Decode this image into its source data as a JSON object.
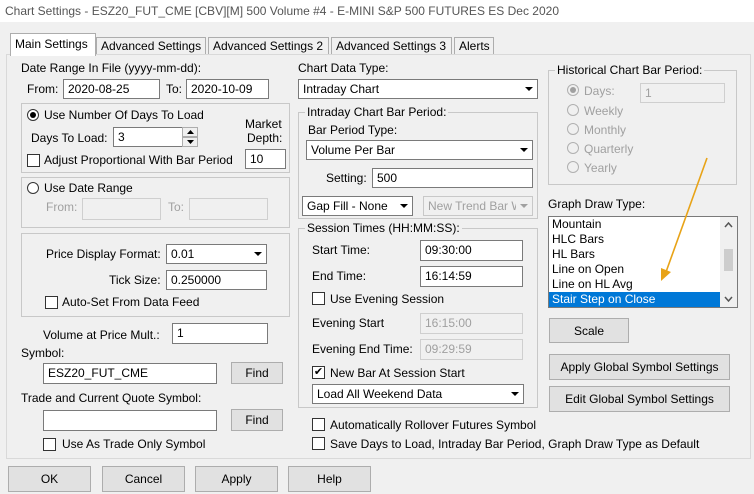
{
  "window": {
    "title": "Chart Settings - ESZ20_FUT_CME [CBV][M]  500 Volume  #4 - E-MINI S&P 500 FUTURES ES Dec 2020"
  },
  "tabs": [
    "Main Settings",
    "Advanced Settings",
    "Advanced Settings 2",
    "Advanced Settings 3",
    "Alerts"
  ],
  "date_range": {
    "label": "Date Range In File (yyyy-mm-dd):",
    "from_label": "From:",
    "from_value": "2020-08-25",
    "to_label": "To:",
    "to_value": "2020-10-09"
  },
  "days_to_load": {
    "radio_label": "Use Number Of Days To Load",
    "days_label": "Days To Load:",
    "days_value": "3",
    "market_depth_label_1": "Market",
    "market_depth_label_2": "Depth:",
    "market_depth_value": "10",
    "adjust_label": "Adjust Proportional With Bar Period"
  },
  "use_date_range": {
    "radio_label": "Use Date Range",
    "from_label": "From:",
    "to_label": "To:"
  },
  "price": {
    "format_label": "Price Display Format:",
    "format_value": "0.01",
    "tick_label": "Tick Size:",
    "tick_value": "0.250000",
    "auto_set_label": "Auto-Set From Data Feed"
  },
  "symbol": {
    "vap_label": "Volume at Price Mult.:",
    "vap_value": "1",
    "symbol_label": "Symbol:",
    "symbol_value": "ESZ20_FUT_CME",
    "find_label": "Find",
    "trade_label": "Trade and Current Quote Symbol:",
    "trade_value": "",
    "trade_find_label": "Find",
    "trade_only_label": "Use As Trade Only Symbol"
  },
  "chart_data_type": {
    "label": "Chart Data Type:",
    "value": "Intraday Chart"
  },
  "intraday_bar_period": {
    "title": "Intraday Chart Bar Period:",
    "type_label": "Bar Period Type:",
    "type_value": "Volume Per Bar",
    "setting_label": "Setting:",
    "setting_value": "500",
    "gap_fill_value": "Gap Fill - None",
    "new_trend_value": "New Trend Bar W"
  },
  "session": {
    "title": "Session Times (HH:MM:SS):",
    "start_label": "Start Time:",
    "start_value": "09:30:00",
    "end_label": "End Time:",
    "end_value": "16:14:59",
    "use_evening_label": "Use Evening Session",
    "evening_start_label": "Evening Start",
    "evening_start_value": "16:15:00",
    "evening_end_label": "Evening End Time:",
    "evening_end_value": "09:29:59",
    "new_bar_label": "New Bar At Session Start",
    "weekend_value": "Load All Weekend Data"
  },
  "historical": {
    "title": "Historical Chart Bar Period:",
    "days_label": "Days:",
    "days_value": "1",
    "weekly_label": "Weekly",
    "monthly_label": "Monthly",
    "quarterly_label": "Quarterly",
    "yearly_label": "Yearly"
  },
  "graph_draw": {
    "label": "Graph Draw Type:",
    "items": [
      "Mountain",
      "HLC Bars",
      "HL Bars",
      "Line on Open",
      "Line on HL Avg",
      "Stair Step on Close"
    ],
    "selected": "Stair Step on Close",
    "annotation_color": "#e8a317"
  },
  "right_buttons": {
    "scale": "Scale",
    "apply_global": "Apply Global Symbol Settings",
    "edit_global": "Edit Global Symbol Settings"
  },
  "bottom_options": {
    "auto_rollover": "Automatically Rollover Futures Symbol",
    "save_days": "Save Days to Load, Intraday Bar Period, Graph Draw Type as Default"
  },
  "footer": {
    "ok": "OK",
    "cancel": "Cancel",
    "apply": "Apply",
    "help": "Help"
  },
  "colors": {
    "selection": "#0078d7",
    "window_bg": "#f0f0f0"
  }
}
